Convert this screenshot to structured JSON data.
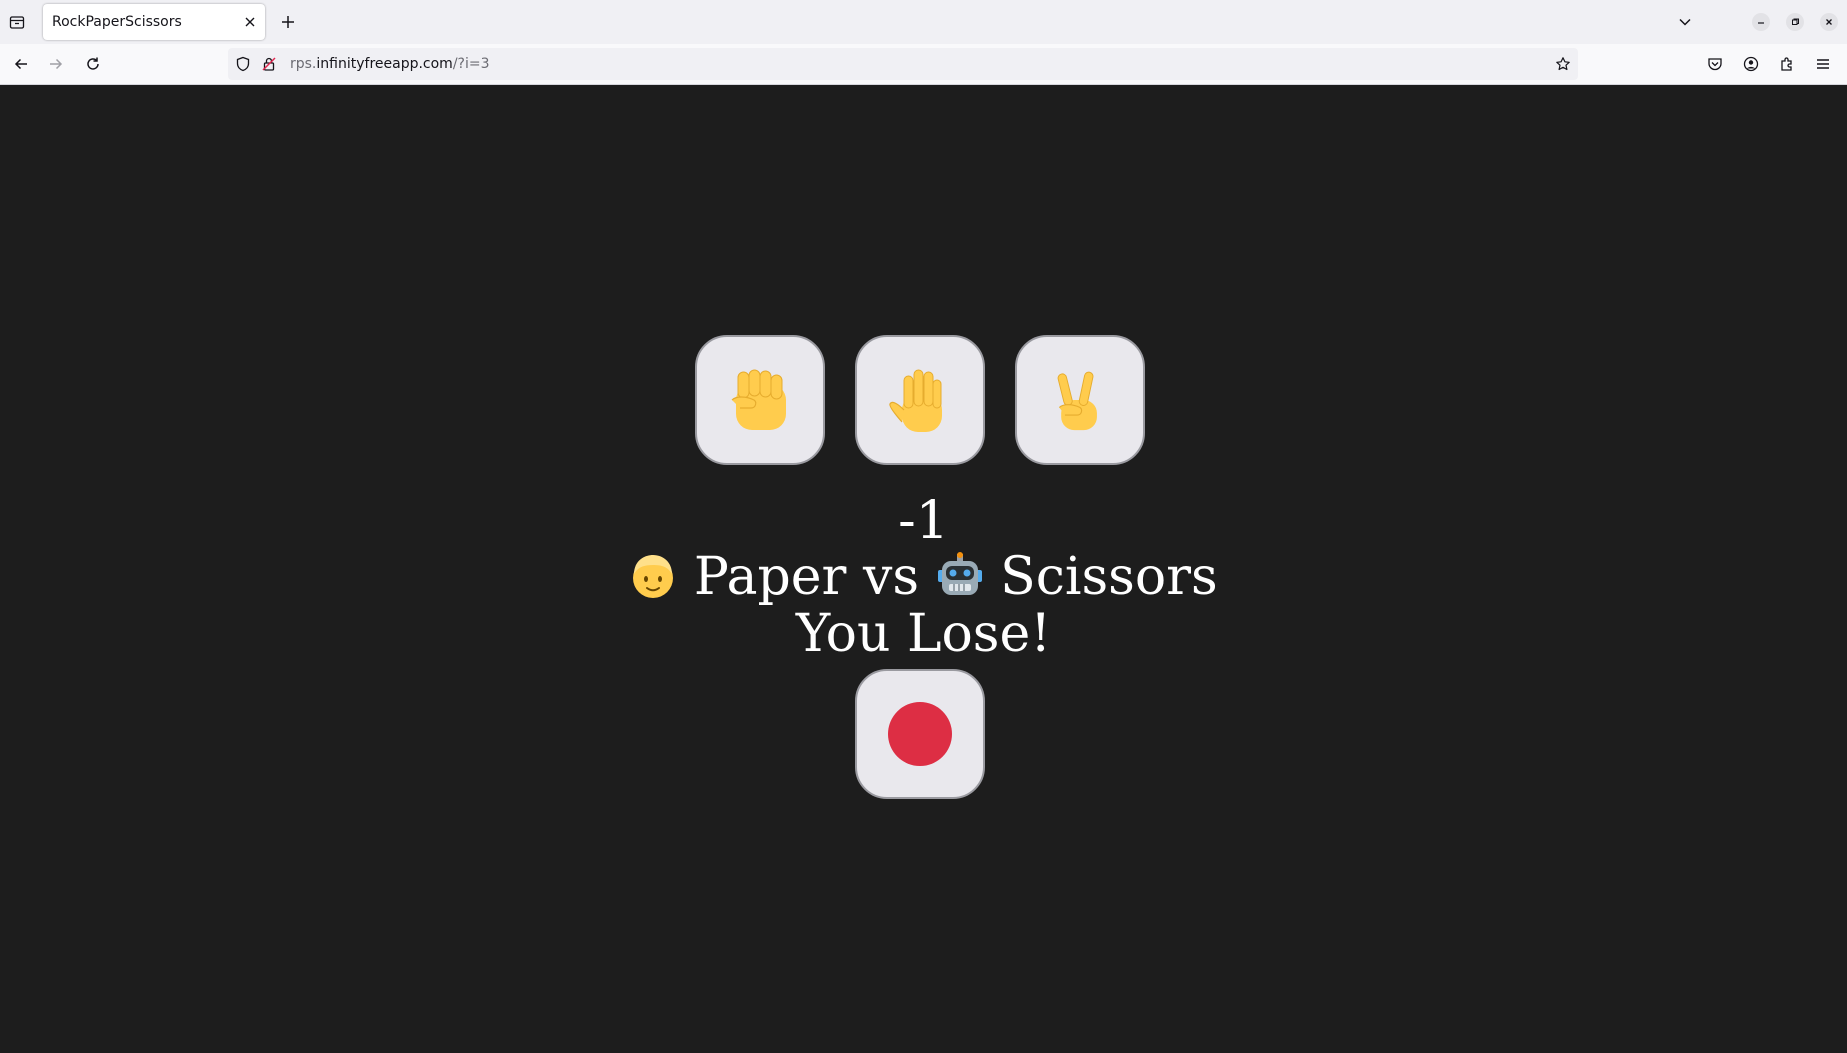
{
  "browser": {
    "tab_title": "RockPaperScissors",
    "url_host_prefix": "rps.",
    "url_host_main": "infinityfreeapp.com",
    "url_path": "/?i=3"
  },
  "game": {
    "choices": [
      {
        "name": "Rock",
        "icon": "raised-fist-icon"
      },
      {
        "name": "Paper",
        "icon": "raised-hand-icon"
      },
      {
        "name": "Scissors",
        "icon": "victory-hand-icon"
      }
    ],
    "score": "-1",
    "player_choice": "Paper",
    "versus_word": "vs",
    "computer_choice": "Scissors",
    "result": "You Lose!",
    "status_icon": "red-circle-icon"
  },
  "colors": {
    "page_background": "#1d1d1d",
    "button_background": "#e9e8ed",
    "status_red": "#dd2e44",
    "emoji_yellow": "#ffcc4d"
  }
}
